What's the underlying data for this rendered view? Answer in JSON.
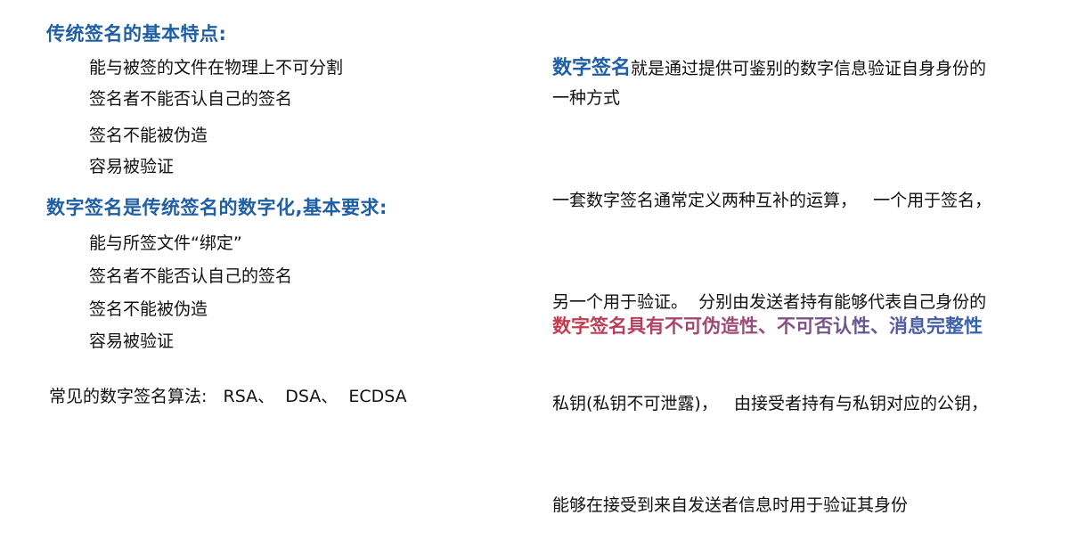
{
  "left": {
    "traditional": {
      "heading": "传统签名的基本特点:",
      "items": [
        "能与被签的文件在物理上不可分割",
        "签名者不能否认自己的签名",
        "签名不能被伪造",
        "容易被验证"
      ]
    },
    "digital": {
      "heading": "数字签名是传统签名的数字化,基本要求:",
      "items": [
        "能与所签文件“绑定”",
        "签名者不能否认自己的签名",
        "签名不能被伪造",
        "容易被验证"
      ]
    },
    "algorithms": "常见的数字签名算法:   RSA、  DSA、  ECDSA"
  },
  "right": {
    "term": "数字签名",
    "definition_rest": "就是通过提供可鉴别的数字信息验证自身身份的",
    "definition_line2": "一种方式",
    "paragraph": [
      "一套数字签名通常定义两种互补的运算，   一个用于签名，",
      "另一个用于验证。  分别由发送者持有能够代表自己身份的",
      "私钥(私钥不可泄露)，   由接受者持有与私钥对应的公钥，",
      "能够在接受到来自发送者信息时用于验证其身份"
    ],
    "properties": "数字签名具有不可伪造性、不可否认性、消息完整性"
  },
  "colors": {
    "heading_blue": "#1f5fa5",
    "gradient_start": "#c83a4a",
    "gradient_mid": "#9a4a7a",
    "gradient_end": "#2f64b0"
  }
}
